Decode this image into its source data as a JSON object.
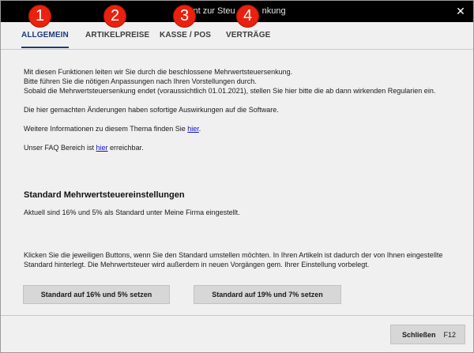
{
  "window": {
    "title_visible": "ent zur Steu",
    "title_tail": "nkung"
  },
  "tabs": [
    {
      "label": "ALLGEMEIN",
      "active": true
    },
    {
      "label": "ARTIKELPREISE",
      "active": false
    },
    {
      "label": "KASSE / POS",
      "active": false
    },
    {
      "label": "VERTRÄGE",
      "active": false
    }
  ],
  "markers": [
    "1",
    "2",
    "3",
    "4"
  ],
  "intro": {
    "line1": "Mit diesen Funktionen leiten wir Sie durch die beschlossene Mehrwertsteuersenkung.",
    "line2": "Bitte führen Sie die nötigen Anpassungen nach Ihren Vorstellungen durch.",
    "line3": "Sobald die Mehrwertsteuersenkung endet (voraussichtlich 01.01.2021), stellen Sie hier bitte die ab dann wirkenden Regularien ein.",
    "effects": "Die hier gemachten Änderungen haben sofortige Auswirkungen auf die Software.",
    "info_prefix": "Weitere Informationen zu diesem Thema finden Sie ",
    "info_link": "hier",
    "info_suffix": ".",
    "faq_prefix": "Unser FAQ Bereich ist ",
    "faq_link": "hier",
    "faq_suffix": " erreichbar."
  },
  "standard": {
    "heading": "Standard Mehrwertsteuereinstellungen",
    "current": "Aktuell sind 16% und 5% als Standard unter Meine Firma eingestellt.",
    "instruction": "Klicken Sie die jeweiligen Buttons, wenn Sie den Standard umstellen möchten. In Ihren Artikeln ist dadurch der von Ihnen eingestellte Standard hinterlegt. Die Mehrwertsteuer wird außerdem in neuen Vorgängen gem. Ihrer Einstellung vorbelegt.",
    "btn_16": "Standard auf 16% und 5% setzen",
    "btn_19": "Standard auf 19% und 7% setzen"
  },
  "footer": {
    "close_label": "Schließen",
    "close_key": "F12"
  },
  "colors": {
    "accent": "#1e3a7a",
    "marker": "#e8220f",
    "link": "#1010c8"
  }
}
